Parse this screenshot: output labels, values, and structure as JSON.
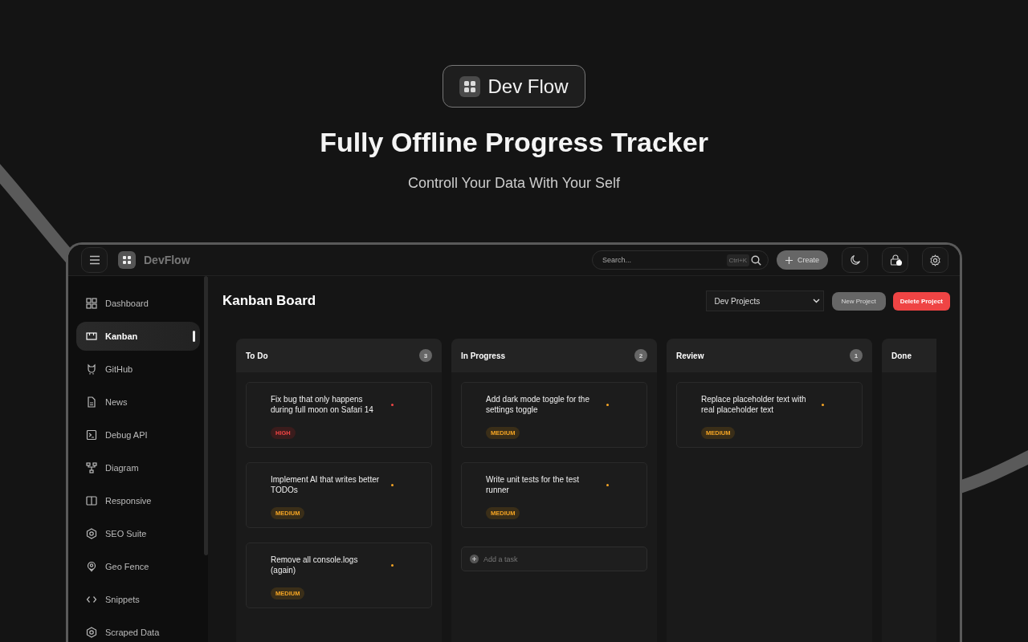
{
  "hero": {
    "brand": "Dev Flow",
    "title": "Fully Offline Progress Tracker",
    "subtitle": "Controll Your Data With Your Self"
  },
  "topbar": {
    "brand": "DevFlow",
    "search": {
      "placeholder": "Search...",
      "shortcut": "Ctrl+K"
    },
    "create": "Create",
    "notification": true
  },
  "sidebar": {
    "items": [
      {
        "label": "Dashboard",
        "selected": false
      },
      {
        "label": "Kanban",
        "selected": true
      },
      {
        "label": "GitHub",
        "selected": false
      },
      {
        "label": "News",
        "selected": false
      },
      {
        "label": "Debug API",
        "selected": false
      },
      {
        "label": "Diagram",
        "selected": false
      },
      {
        "label": "Responsive",
        "selected": false
      },
      {
        "label": "SEO Suite",
        "selected": false
      },
      {
        "label": "Geo Fence",
        "selected": false
      },
      {
        "label": "Snippets",
        "selected": false
      },
      {
        "label": "Scraped Data",
        "selected": false
      }
    ]
  },
  "board": {
    "title": "Kanban Board",
    "project": "Dev Projects",
    "new_project": "New Project",
    "delete_project": "Delete Project",
    "columns": [
      {
        "title": "To Do",
        "count": "3",
        "cards": [
          {
            "title": "Fix bug that only happens during full moon on Safari 14",
            "priority": "HIGH",
            "kind": "high"
          },
          {
            "title": "Implement AI that writes better TODOs",
            "priority": "MEDIUM",
            "kind": "medium"
          },
          {
            "title": "Remove all console.logs (again)",
            "priority": "MEDIUM",
            "kind": "medium"
          }
        ]
      },
      {
        "title": "In Progress",
        "count": "2",
        "add_task": "Add a task",
        "cards": [
          {
            "title": "Add dark mode toggle for the settings toggle",
            "priority": "MEDIUM",
            "kind": "medium"
          },
          {
            "title": "Write unit tests for the test runner",
            "priority": "MEDIUM",
            "kind": "medium"
          }
        ]
      },
      {
        "title": "Review",
        "count": "1",
        "cards": [
          {
            "title": "Replace placeholder text with real placeholder text",
            "priority": "MEDIUM",
            "kind": "medium"
          }
        ]
      },
      {
        "title": "Done"
      }
    ]
  }
}
